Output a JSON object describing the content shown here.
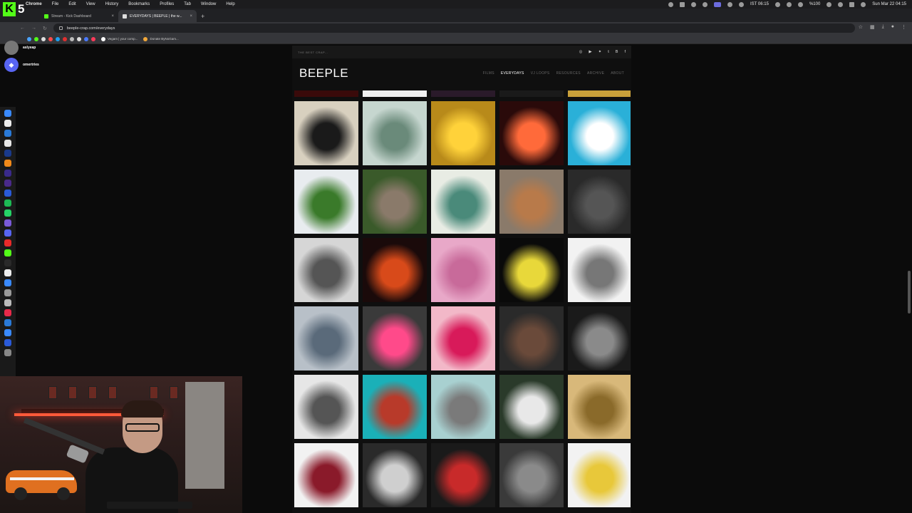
{
  "menubar": {
    "app": "Chrome",
    "items": [
      "File",
      "Edit",
      "View",
      "History",
      "Bookmarks",
      "Profiles",
      "Tab",
      "Window",
      "Help"
    ],
    "time_ist": "IST 06:15",
    "battery": "%100",
    "datetime": "Sun Mar 22  04:15"
  },
  "overlay": {
    "logo_letter": "K",
    "logo_number": "5"
  },
  "tabs": [
    {
      "label": "Stream - Kick Dashboard",
      "active": false
    },
    {
      "label": "EVERYDAYS | BEEPLE | the w...",
      "active": true
    }
  ],
  "browser": {
    "url": "beeple-crap.com/everydays"
  },
  "bookmarks": [
    {
      "label": "Vegam | your comp..."
    },
    {
      "label": "Donate ByNoGam..."
    }
  ],
  "chat": [
    {
      "name": "aslyeap"
    },
    {
      "name": "omertries"
    }
  ],
  "site": {
    "tagline": "THE BEST CRAP...",
    "logo": "BEEPLE",
    "nav": [
      {
        "label": "FILMS",
        "active": false
      },
      {
        "label": "EVERYDAYS",
        "active": true
      },
      {
        "label": "VJ LOOPS",
        "active": false
      },
      {
        "label": "RESOURCES",
        "active": false
      },
      {
        "label": "ARCHIVE",
        "active": false
      },
      {
        "label": "ABOUT",
        "active": false
      }
    ],
    "socials": [
      "instagram-icon",
      "youtube-icon",
      "twitter-icon",
      "tumblr-icon",
      "behance-icon",
      "facebook-icon"
    ]
  },
  "gallery": {
    "columns": 5,
    "thumbs": [
      {
        "bg": "#3a0a0a"
      },
      {
        "bg": "#f0f0f0"
      },
      {
        "bg": "#2a1a2a"
      },
      {
        "bg": "#1a1a1a"
      },
      {
        "bg": "#c9a03a"
      },
      {
        "bg": "#d8d0bf",
        "fg": "#1a1a1a"
      },
      {
        "bg": "#c6d6cf",
        "fg": "#6a8a7a"
      },
      {
        "bg": "#b88a1a",
        "fg": "#ffd23a"
      },
      {
        "bg": "#2a0a0a",
        "fg": "#ff6a3a"
      },
      {
        "bg": "#2ab0d8",
        "fg": "#ffffff"
      },
      {
        "bg": "#e8ecef",
        "fg": "#3a7a2a"
      },
      {
        "bg": "#3a5a2a",
        "fg": "#8a7a6a"
      },
      {
        "bg": "#e8ece4",
        "fg": "#4a8a7a"
      },
      {
        "bg": "#8a7a6a",
        "fg": "#b87a4a"
      },
      {
        "bg": "#2a2a2a",
        "fg": "#555555"
      },
      {
        "bg": "#d6d6d6",
        "fg": "#555555"
      },
      {
        "bg": "#1a0a0a",
        "fg": "#d84a1a"
      },
      {
        "bg": "#e8a8c8",
        "fg": "#c86a9a"
      },
      {
        "bg": "#0a0a0a",
        "fg": "#e8d83a"
      },
      {
        "bg": "#f2f2f2",
        "fg": "#777777"
      },
      {
        "bg": "#b8c0c8",
        "fg": "#5a6a7a"
      },
      {
        "bg": "#3a3a3a",
        "fg": "#ff4a8a"
      },
      {
        "bg": "#f2b8c8",
        "fg": "#d81a5a"
      },
      {
        "bg": "#2a2a2a",
        "fg": "#6a4a3a"
      },
      {
        "bg": "#1a1a1a",
        "fg": "#8a8a8a"
      },
      {
        "bg": "#e6e6e6",
        "fg": "#555555"
      },
      {
        "bg": "#1ab0b8",
        "fg": "#b83a2a"
      },
      {
        "bg": "#a8d0d0",
        "fg": "#7a7a7a"
      },
      {
        "bg": "#2a3a2a",
        "fg": "#e8e8e8"
      },
      {
        "bg": "#d8b87a",
        "fg": "#8a6a2a"
      },
      {
        "bg": "#f2f2f2",
        "fg": "#8a1a2a"
      },
      {
        "bg": "#2a2a2a",
        "fg": "#cfcfcf"
      },
      {
        "bg": "#1a1a1a",
        "fg": "#c82a2a"
      },
      {
        "bg": "#3a3a3a",
        "fg": "#8a8a8a"
      },
      {
        "bg": "#f2f2f2",
        "fg": "#e8c83a"
      }
    ]
  }
}
